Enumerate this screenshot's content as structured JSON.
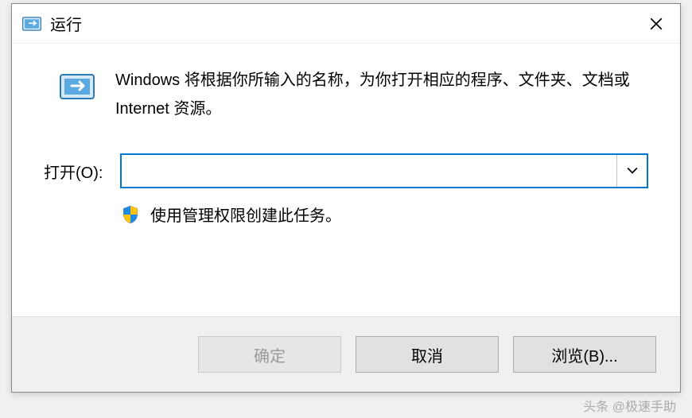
{
  "titlebar": {
    "title": "运行"
  },
  "description": "Windows 将根据你所输入的名称，为你打开相应的程序、文件夹、文档或 Internet 资源。",
  "input": {
    "label": "打开(O):",
    "value": ""
  },
  "admin_note": "使用管理权限创建此任务。",
  "buttons": {
    "ok": "确定",
    "cancel": "取消",
    "browse": "浏览(B)..."
  },
  "watermark": "头条 @极速手助"
}
